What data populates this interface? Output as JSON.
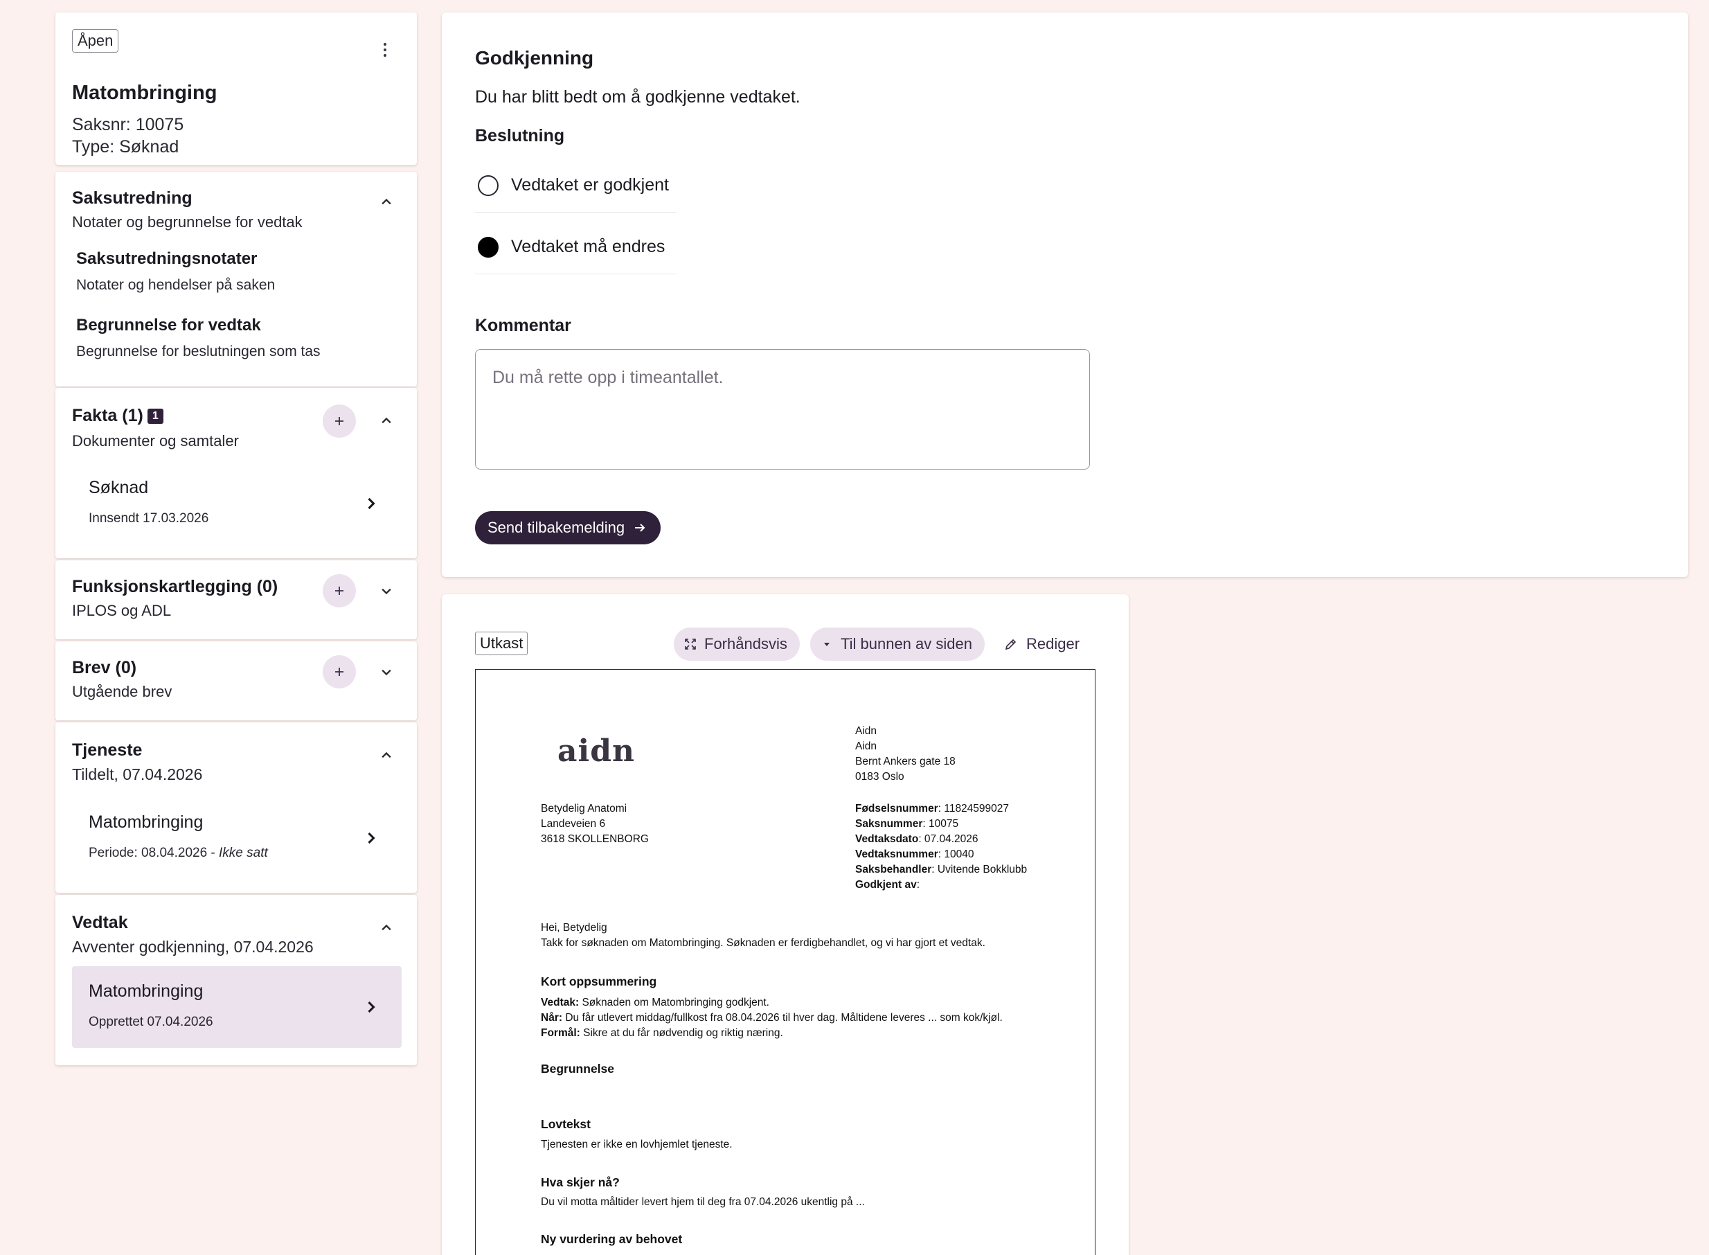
{
  "case": {
    "status": "Åpen",
    "title": "Matombringing",
    "case_number": "Saksnr: 10075",
    "type": "Type: Søknad"
  },
  "saksutredning": {
    "title": "Saksutredning",
    "subtitle": "Notater og begrunnelse for vedtak",
    "items": [
      {
        "title": "Saksutredningsnotater",
        "subtitle": "Notater og hendelser på saken"
      },
      {
        "title": "Begrunnelse for vedtak",
        "subtitle": "Begrunnelse for beslutningen som tas"
      }
    ]
  },
  "fakta": {
    "title": "Fakta (1)",
    "badge": "1",
    "subtitle": "Dokumenter og samtaler",
    "item": {
      "title": "Søknad",
      "subtitle": "Innsendt 17.03.2026"
    }
  },
  "funksjon": {
    "title": "Funksjonskartlegging (0)",
    "subtitle": "IPLOS og ADL"
  },
  "brev": {
    "title": "Brev (0)",
    "subtitle": "Utgående brev"
  },
  "tjeneste": {
    "title": "Tjeneste",
    "subtitle": "Tildelt, 07.04.2026",
    "item": {
      "title": "Matombringing",
      "period": "Periode: 08.04.2026 - ",
      "period_status": "Ikke satt"
    }
  },
  "vedtak": {
    "title": "Vedtak",
    "subtitle": "Avventer godkjenning, 07.04.2026",
    "item": {
      "title": "Matombringing",
      "subtitle": "Opprettet 07.04.2026"
    }
  },
  "approval": {
    "title": "Godkjenning",
    "description": "Du har blitt bedt om å godkjenne vedtaket.",
    "decision_label": "Beslutning",
    "options": [
      {
        "label": "Vedtaket er godkjent",
        "selected": false
      },
      {
        "label": "Vedtaket må endres",
        "selected": true
      }
    ],
    "comment_label": "Kommentar",
    "comment_placeholder": "Du må rette opp i timeantallet.",
    "send_label": "Send tilbakemelding"
  },
  "document": {
    "status": "Utkast",
    "preview_label": "Forhåndsvis",
    "bottom_label": "Til bunnen av siden",
    "edit_label": "Rediger",
    "logo": "aidn",
    "sender": [
      "Aidn",
      "Aidn",
      "Bernt Ankers gate 18",
      "0183 Oslo"
    ],
    "recipient": [
      "Betydelig Anatomi",
      "Landeveien 6",
      "3618 SKOLLENBORG"
    ],
    "meta": [
      {
        "label": "Fødselsnummer",
        "value": ": 11824599027"
      },
      {
        "label": "Saksnummer",
        "value": ": 10075"
      },
      {
        "label": "Vedtaksdato",
        "value": ": 07.04.2026"
      },
      {
        "label": "Vedtaksnummer",
        "value": ": 10040"
      },
      {
        "label": "Saksbehandler",
        "value": ": Uvitende Bokklubb"
      },
      {
        "label": "Godkjent av",
        "value": ":"
      }
    ],
    "greeting": "Hei, Betydelig",
    "intro": "Takk for søknaden om Matombringing. Søknaden er ferdigbehandlet, og vi har gjort et vedtak.",
    "summary_title": "Kort oppsummering",
    "summary": [
      {
        "label": "Vedtak:",
        "text": " Søknaden om Matombringing godkjent."
      },
      {
        "label": "Når:",
        "text": " Du får utlevert middag/fullkost fra 08.04.2026 til hver dag. Måltidene leveres ... som kok/kjøl."
      },
      {
        "label": "Formål:",
        "text": " Sikre at du får nødvendig og riktig næring."
      }
    ],
    "reason_title": "Begrunnelse",
    "law_title": "Lovtekst",
    "law_text": "Tjenesten er ikke en lovhjemlet tjeneste.",
    "next_title": "Hva skjer nå?",
    "next_text": "Du vil motta måltider levert hjem til deg fra 07.04.2026 ukentlig på ...",
    "reassess_title": "Ny vurdering av behovet"
  },
  "icons": {
    "menu": "kebab-icon",
    "expand": "chevron-up-icon",
    "collapse": "chevron-down-icon",
    "add": "plus-icon",
    "open": "chevron-right-icon",
    "send": "arrow-right-icon",
    "preview": "expand-icon",
    "scroll": "caret-down-icon",
    "edit": "pencil-icon"
  },
  "colors": {
    "background": "#fcf1ee",
    "accent_dark": "#2f2139",
    "accent_light": "#ece2ee",
    "selected_row": "#ebe2ee"
  }
}
